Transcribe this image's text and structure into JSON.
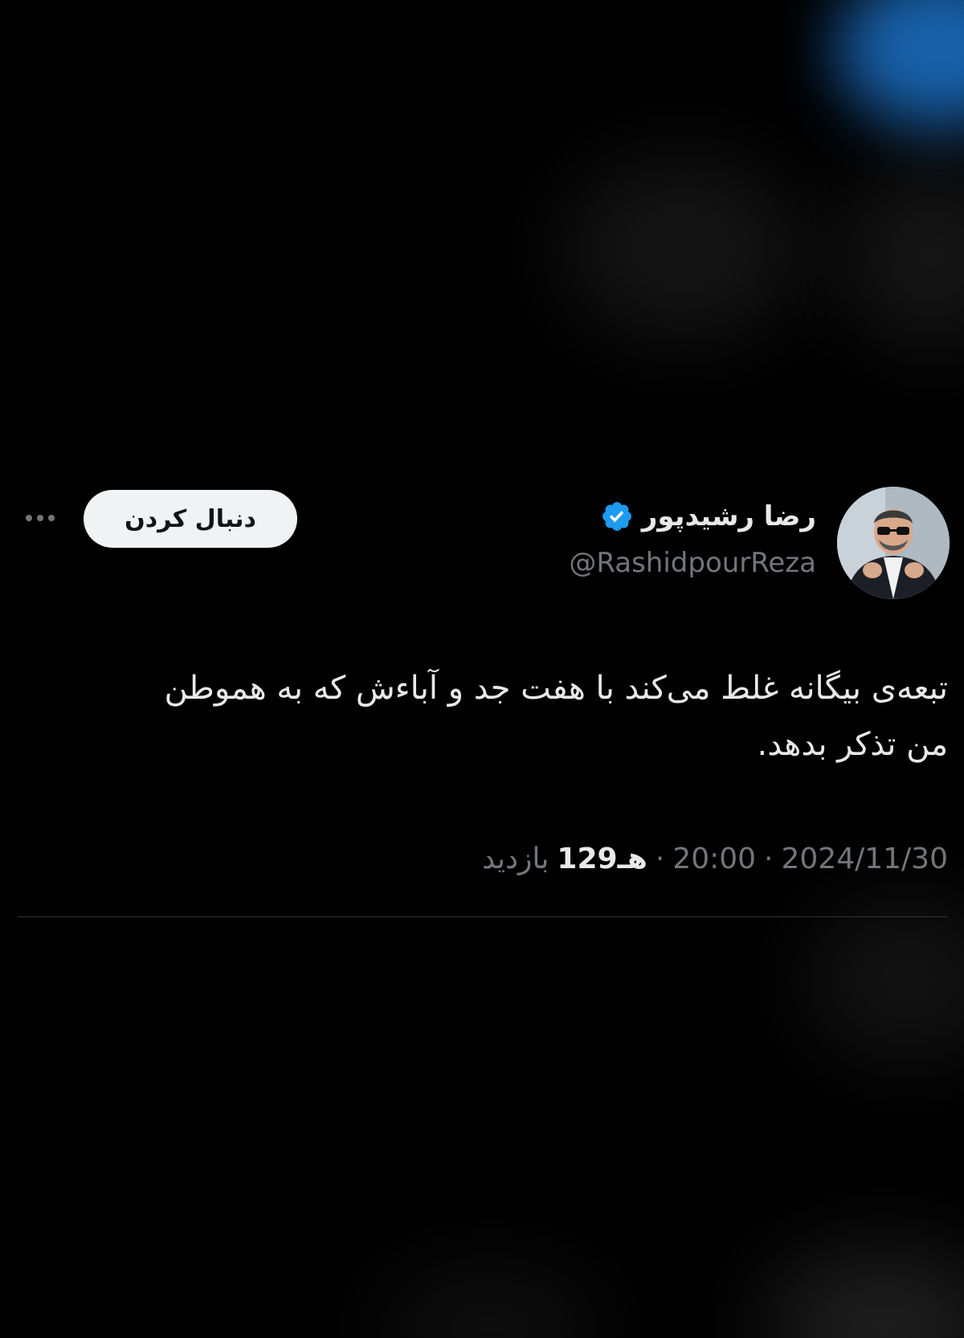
{
  "tweet": {
    "display_name": "رضا رشیدپور",
    "handle": "@RashidpourReza",
    "follow_label": "دنبال کردن",
    "text": "تبعه‌ی بیگانه غلط می‌کند با هفت جد و آباءش که به هموطن من تذکر بدهد.",
    "date": "2024/11/30",
    "separator": "·",
    "time": "20:00",
    "views_count": "129هـ",
    "views_label": "بازدید"
  },
  "icons": {
    "verified": "verified-badge-icon",
    "more": "more-dots-icon"
  },
  "colors": {
    "background": "#000000",
    "text": "#e7e9ea",
    "secondary": "#71767b",
    "verified": "#1d9bf0",
    "follow_button_bg": "#eff3f4",
    "divider": "#2f3336"
  }
}
